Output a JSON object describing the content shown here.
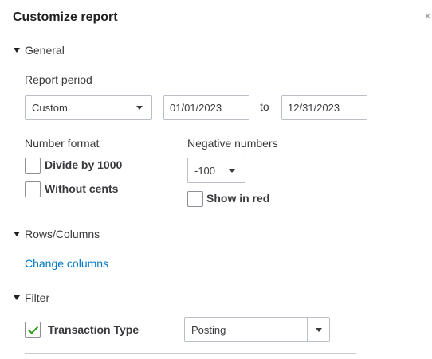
{
  "dialog": {
    "title": "Customize report",
    "close_glyph": "×"
  },
  "general": {
    "section_label": "General",
    "report_period": {
      "label": "Report period",
      "selected": "Custom",
      "from_date": "01/01/2023",
      "to_label": "to",
      "to_date": "12/31/2023"
    },
    "number_format": {
      "label": "Number format",
      "divide_by_1000": {
        "label": "Divide by 1000",
        "checked": false
      },
      "without_cents": {
        "label": "Without cents",
        "checked": false
      }
    },
    "negative_numbers": {
      "label": "Negative numbers",
      "selected": "-100",
      "show_in_red": {
        "label": "Show in red",
        "checked": false
      }
    }
  },
  "rows_columns": {
    "section_label": "Rows/Columns",
    "change_columns_link": "Change columns"
  },
  "filter": {
    "section_label": "Filter",
    "transaction_type": {
      "label": "Transaction Type",
      "checked": true,
      "selected": "Posting"
    }
  },
  "colors": {
    "link": "#0077c5",
    "check": "#2ca01c",
    "border": "#babec5"
  },
  "icons": {
    "close": "close-icon",
    "collapse": "triangle-down-icon",
    "dropdown": "chevron-down-icon",
    "check": "checkmark-icon"
  }
}
